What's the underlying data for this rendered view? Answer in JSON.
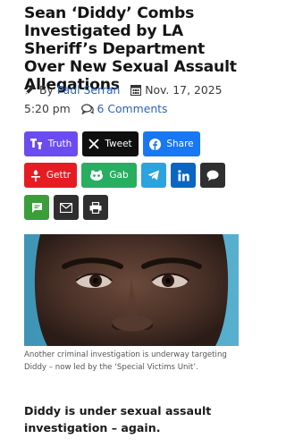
{
  "article": {
    "title": "Sean ‘Diddy’ Combs Investigated by LA Sheriff’s Department Over New Sexual Assault Allegations",
    "byline_prefix": "By",
    "author": "Paul Serran",
    "date": "Nov. 17, 2025 5:20 pm",
    "comments": "6 Comments"
  },
  "share": {
    "truth": "Truth",
    "tweet": "Tweet",
    "facebook": "Share",
    "gettr": "Gettr",
    "gab": "Gab"
  },
  "image": {
    "caption": "Another criminal investigation is underway targeting Diddy – now led by the ‘Special Victims Unit’."
  },
  "body": {
    "subhead": "Diddy is under sexual assault investigation – again."
  },
  "colors": {
    "truth": "#6a4cf0",
    "twitter": "#0f0f0f",
    "facebook": "#1877f2",
    "gettr": "#e51d23",
    "gab": "#27ae60",
    "telegram": "#2aa3de",
    "linkedin": "#0a66c2",
    "link": "#2b63b8"
  },
  "icons": [
    "pencil-icon",
    "calendar-icon",
    "comment-icon",
    "truth-social-icon",
    "x-icon",
    "facebook-icon",
    "gettr-icon",
    "gab-icon",
    "telegram-icon",
    "linkedin-icon",
    "speech-bubble-icon",
    "sms-icon",
    "email-icon",
    "print-icon"
  ]
}
